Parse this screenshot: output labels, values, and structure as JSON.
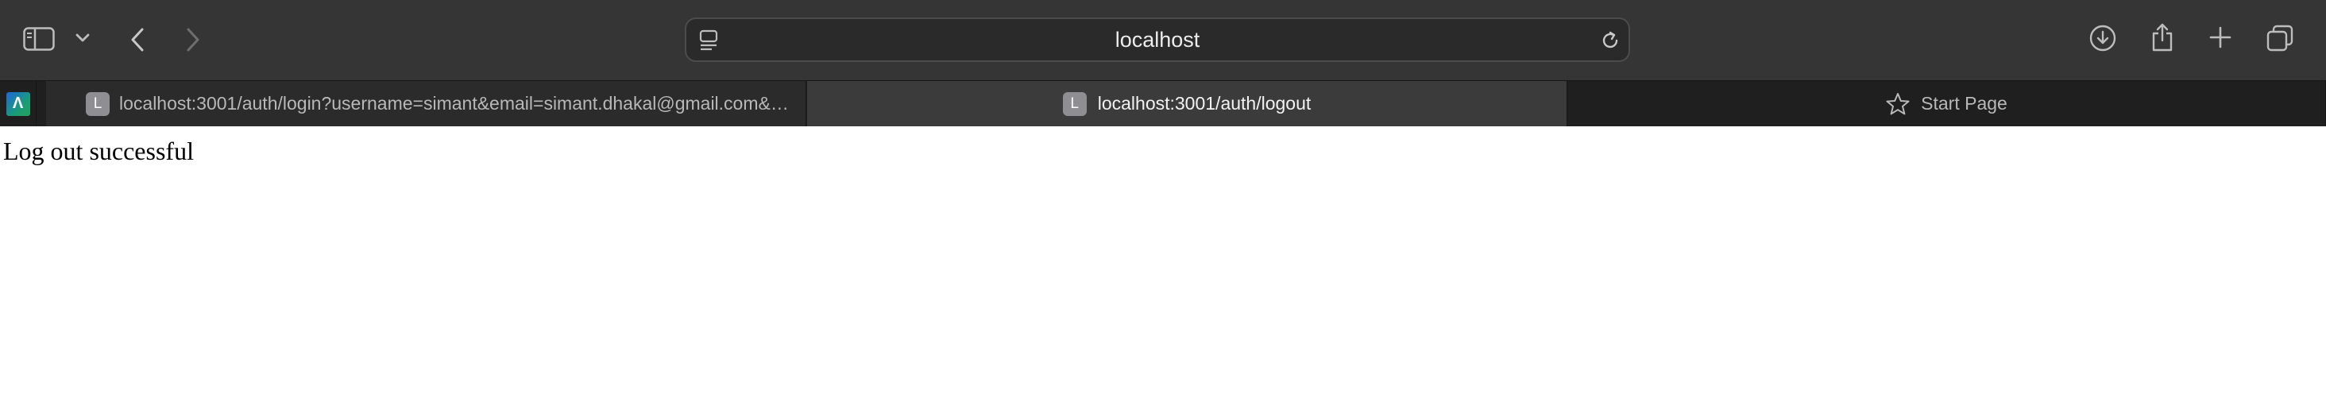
{
  "browser": {
    "address_bar": {
      "url_text": "localhost"
    },
    "toolbar_icons": {
      "sidebar": "sidebar-icon",
      "sidebar_menu": "chevron-down-icon",
      "back": "chevron-left-icon",
      "forward": "chevron-right-icon",
      "page_menu": "page-menu-icon",
      "reload": "reload-icon",
      "downloads": "download-icon",
      "share": "share-icon",
      "new_tab": "plus-icon",
      "tab_overview": "tab-overview-icon"
    },
    "pinned_tab": {
      "favicon_letter": "Λ"
    },
    "tabs": [
      {
        "favicon_letter": "L",
        "title": "localhost:3001/auth/login?username=simant&email=simant.dhakal@gmail.com&p...",
        "active": false
      },
      {
        "favicon_letter": "L",
        "title": "localhost:3001/auth/logout",
        "active": true
      },
      {
        "icon": "star-icon",
        "title": "Start Page",
        "active": false
      }
    ]
  },
  "page": {
    "message": "Log out successful"
  },
  "colors": {
    "toolbar_bg": "#353535",
    "tabbar_bg": "#1f1f1f",
    "active_tab_bg": "#3b3b3b",
    "page_bg": "#ffffff"
  }
}
